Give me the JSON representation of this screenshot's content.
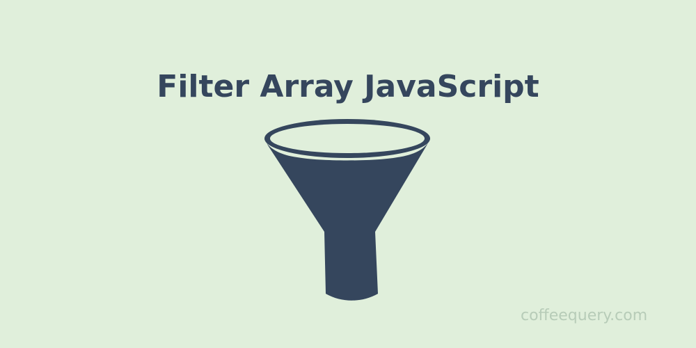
{
  "title": "Filter Array JavaScript",
  "icon": "funnel-icon",
  "watermark": "coffeequery.com",
  "colors": {
    "background": "#e0efdb",
    "ink": "#35465d",
    "watermark": "#b7ccb8"
  }
}
